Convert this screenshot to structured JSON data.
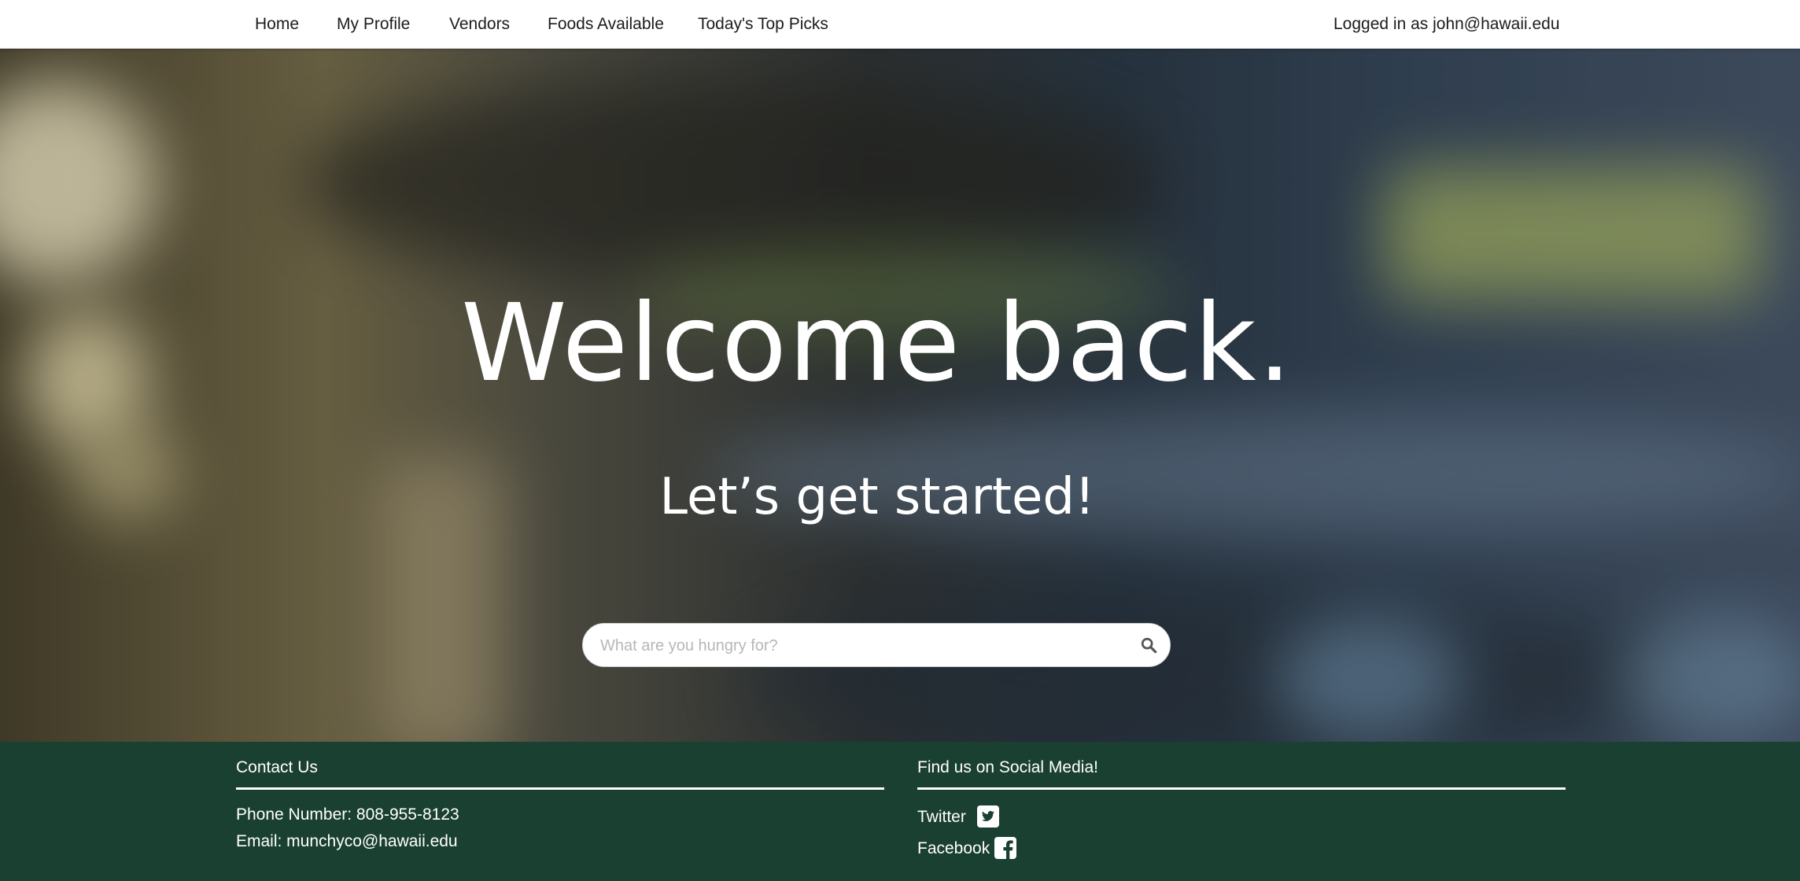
{
  "nav": {
    "items": [
      {
        "label": "Home"
      },
      {
        "label": "My Profile"
      },
      {
        "label": "Vendors"
      },
      {
        "label": "Foods Available"
      },
      {
        "label": "Today's Top Picks"
      }
    ],
    "user_status": "Logged in as john@hawaii.edu"
  },
  "hero": {
    "title": "Welcome back.",
    "subtitle": "Let’s get started!",
    "search": {
      "placeholder": "What are you hungry for?",
      "value": "",
      "icon": "search-icon"
    }
  },
  "footer": {
    "contact": {
      "heading": "Contact Us",
      "phone": "Phone Number: 808-955-8123",
      "email": "Email: munchyco@hawaii.edu"
    },
    "social": {
      "heading": "Find us on Social Media!",
      "links": [
        {
          "label": "Twitter",
          "icon": "twitter-icon"
        },
        {
          "label": "Facebook",
          "icon": "facebook-icon"
        }
      ]
    }
  },
  "colors": {
    "footer_bg": "#1a4032",
    "nav_bg": "#ffffff",
    "text_light": "#ffffff"
  }
}
